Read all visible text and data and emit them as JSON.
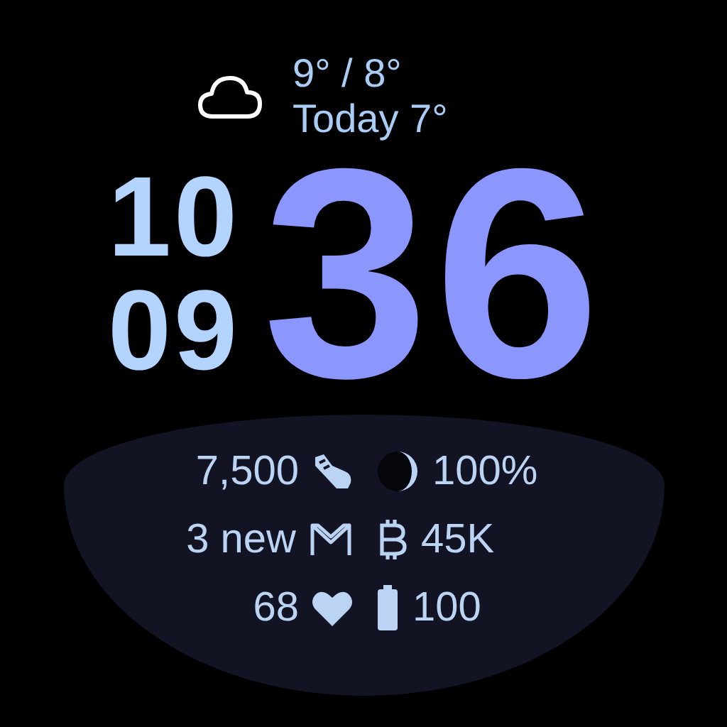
{
  "weather": {
    "range": "9° / 8°",
    "today": "Today 7°"
  },
  "time": {
    "hours": "10",
    "minutes_small": "09",
    "minutes": "36"
  },
  "complications": [
    {
      "left": {
        "kind": "steps",
        "value": "7,500"
      },
      "right": {
        "kind": "moon",
        "value": "100%"
      }
    },
    {
      "left": {
        "kind": "mail",
        "value": "3 new"
      },
      "right": {
        "kind": "bitcoin",
        "value": "45K"
      }
    },
    {
      "left": {
        "kind": "heart",
        "value": "68"
      },
      "right": {
        "kind": "battery",
        "value": "100"
      }
    }
  ]
}
